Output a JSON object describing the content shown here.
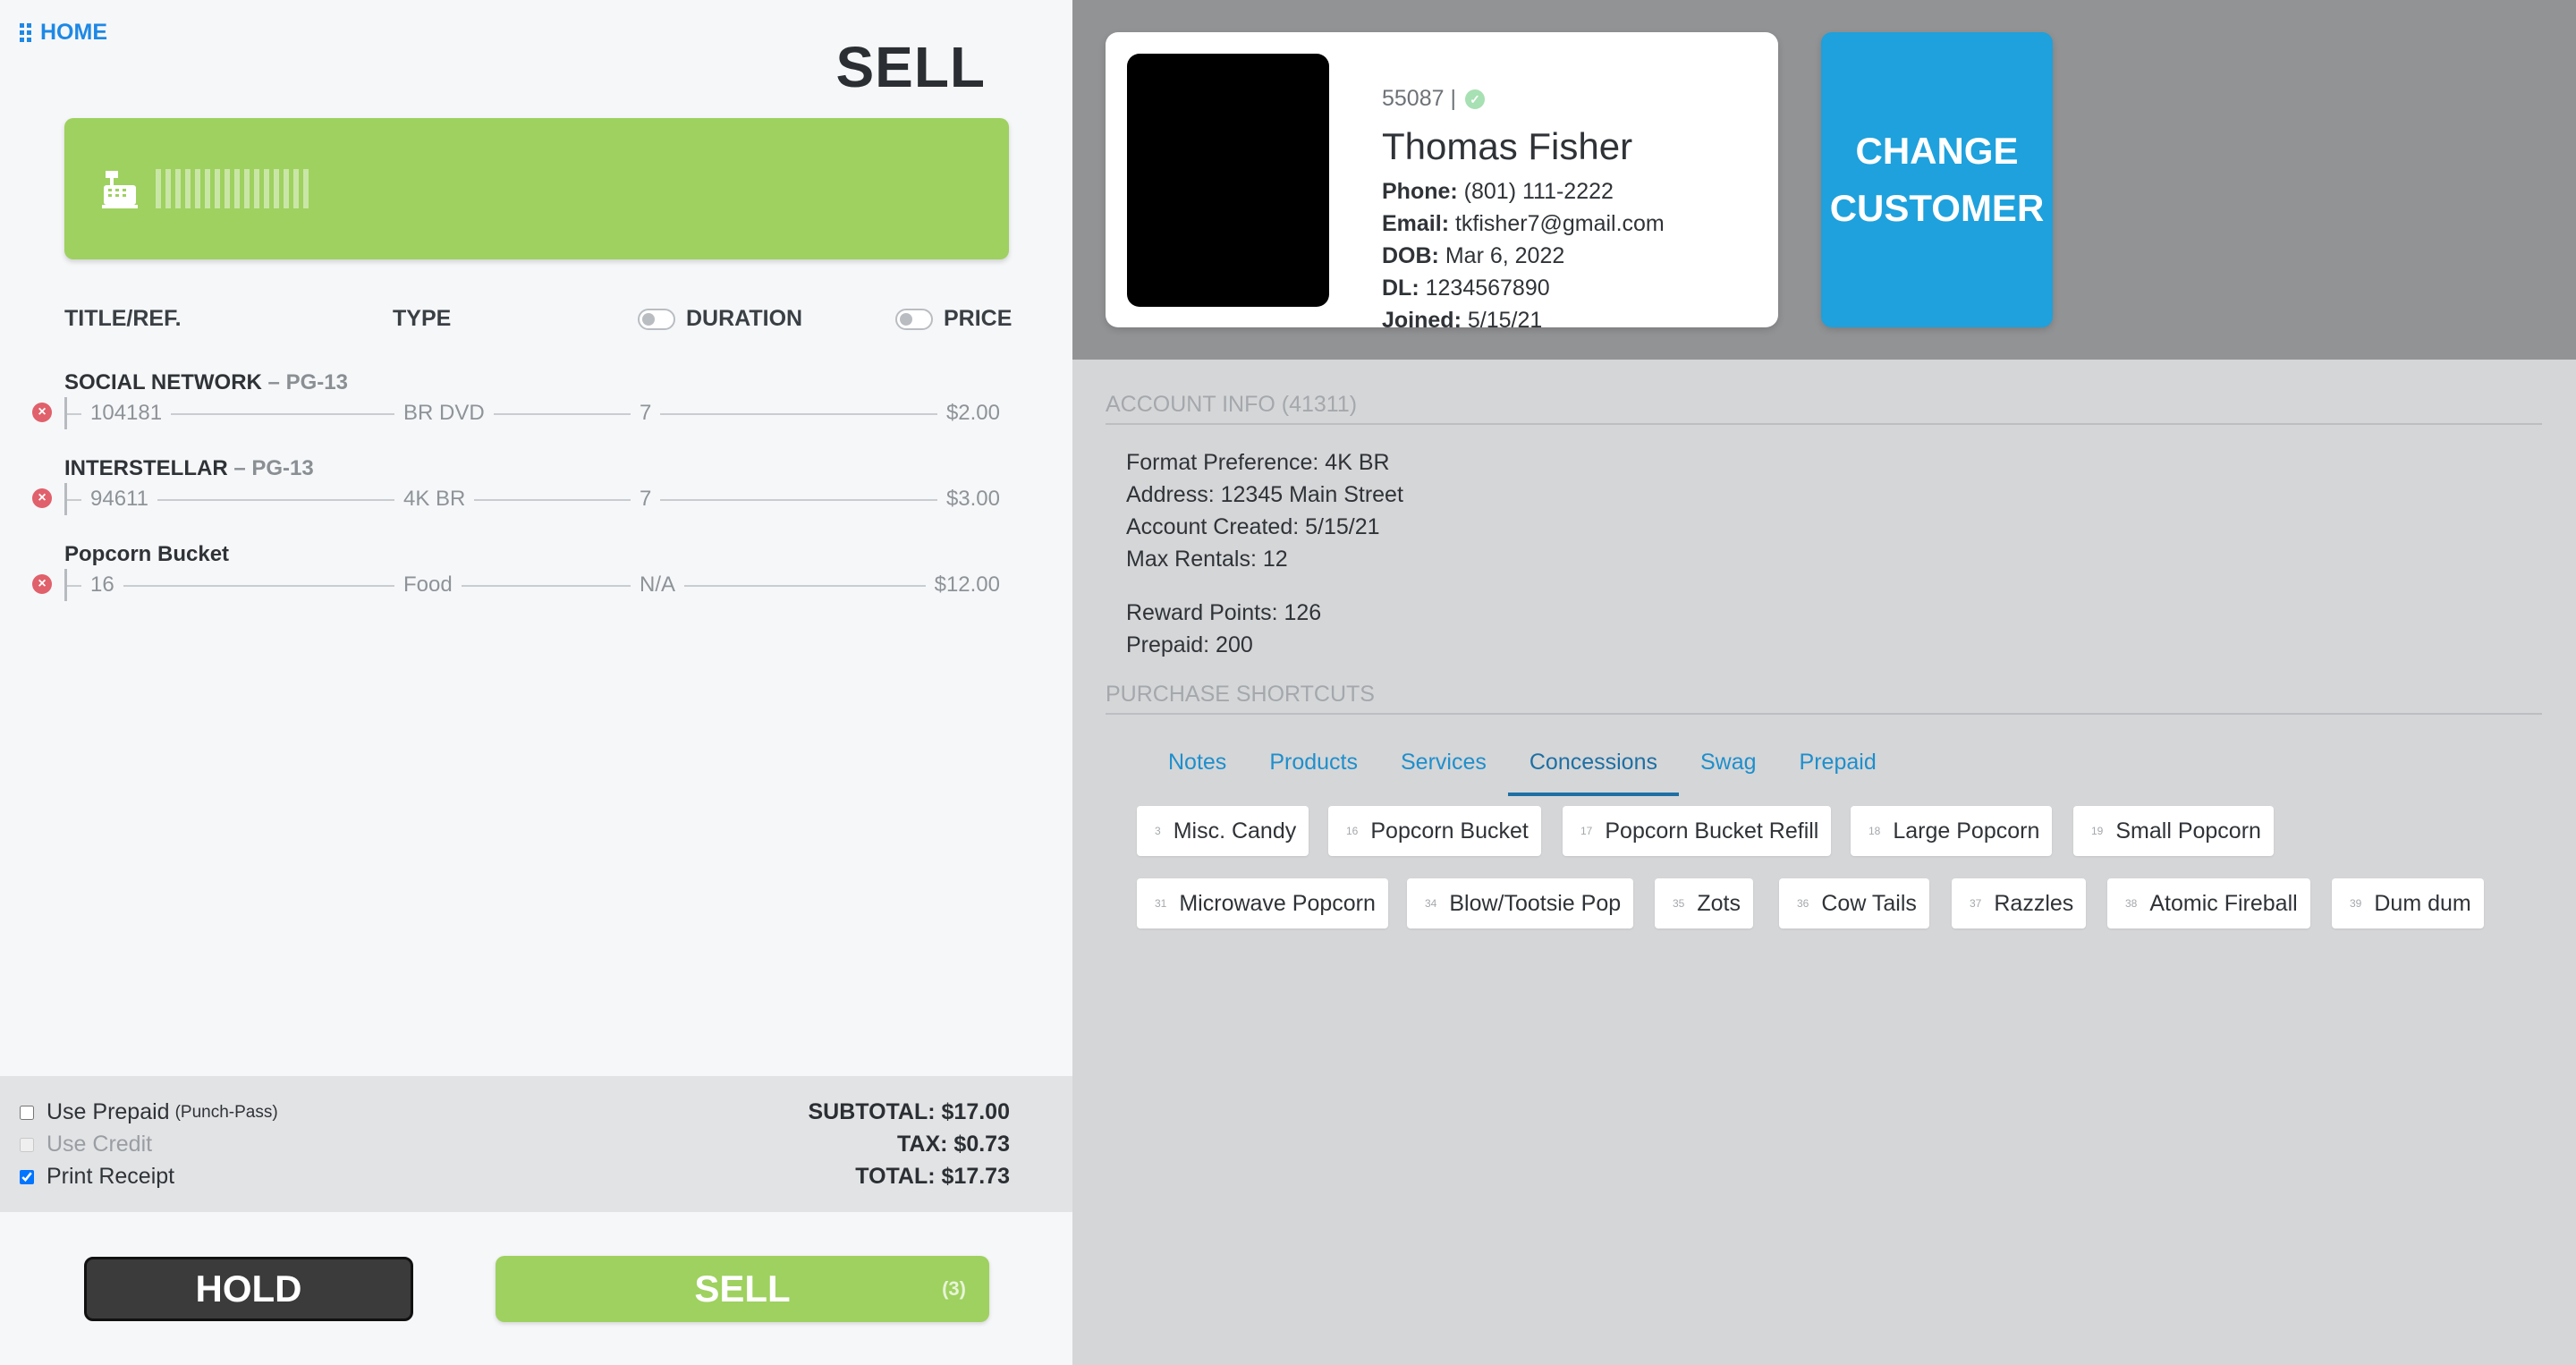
{
  "nav": {
    "home_label": "HOME"
  },
  "page": {
    "title": "SELL"
  },
  "columns": {
    "title": "TITLE/REF.",
    "type": "TYPE",
    "duration": "DURATION",
    "price": "PRICE"
  },
  "items": [
    {
      "title": "SOCIAL NETWORK",
      "rating": " – PG-13",
      "ref": "104181",
      "type": "BR DVD",
      "duration": "7",
      "price": "$2.00"
    },
    {
      "title": "INTERSTELLAR",
      "rating": " – PG-13",
      "ref": "94611",
      "type": "4K BR",
      "duration": "7",
      "price": "$3.00"
    },
    {
      "title": "Popcorn Bucket",
      "rating": "",
      "ref": "16",
      "type": "Food",
      "duration": "N/A",
      "price": "$12.00"
    }
  ],
  "options": {
    "use_prepaid": "Use Prepaid",
    "use_prepaid_note": "(Punch-Pass)",
    "use_credit": "Use Credit",
    "print_receipt": "Print Receipt"
  },
  "totals": {
    "subtotal": "SUBTOTAL: $17.00",
    "tax": "TAX: $0.73",
    "total": "TOTAL: $17.73"
  },
  "actions": {
    "hold": "HOLD",
    "sell": "SELL",
    "sell_count": "(3)"
  },
  "customer": {
    "id": "55087 |",
    "name": "Thomas Fisher",
    "phone_label": "Phone:",
    "phone": "(801) 111-2222",
    "email_label": "Email:",
    "email": "tkfisher7@gmail.com",
    "dob_label": "DOB:",
    "dob": "Mar 6, 2022",
    "dl_label": "DL:",
    "dl": "1234567890",
    "joined_label": "Joined:",
    "joined": "5/15/21",
    "change_line1": "CHANGE",
    "change_line2": "CUSTOMER"
  },
  "account": {
    "title": "ACCOUNT INFO (41311)",
    "format": "Format Preference: 4K BR",
    "address": "Address: 12345 Main Street",
    "created": "Account Created: 5/15/21",
    "max_rentals": "Max Rentals: 12",
    "reward_points": "Reward Points: 126",
    "prepaid": "Prepaid: 200"
  },
  "shortcuts": {
    "title": "PURCHASE SHORTCUTS",
    "tabs": [
      "Notes",
      "Products",
      "Services",
      "Concessions",
      "Swag",
      "Prepaid"
    ],
    "active_tab": "Concessions",
    "chips_row1": [
      {
        "num": "3",
        "label": "Misc. Candy"
      },
      {
        "num": "16",
        "label": "Popcorn Bucket"
      },
      {
        "num": "17",
        "label": "Popcorn Bucket Refill"
      },
      {
        "num": "18",
        "label": "Large Popcorn"
      },
      {
        "num": "19",
        "label": "Small Popcorn"
      }
    ],
    "chips_row2": [
      {
        "num": "31",
        "label": "Microwave Popcorn"
      },
      {
        "num": "34",
        "label": "Blow/Tootsie Pop"
      },
      {
        "num": "35",
        "label": "Zots"
      },
      {
        "num": "36",
        "label": "Cow Tails"
      },
      {
        "num": "37",
        "label": "Razzles"
      },
      {
        "num": "38",
        "label": "Atomic Fireball"
      },
      {
        "num": "39",
        "label": "Dum dum"
      }
    ]
  },
  "colors": {
    "accent_green": "#9ed15f",
    "accent_blue": "#1ea1dc",
    "link_blue": "#1e88e5"
  }
}
